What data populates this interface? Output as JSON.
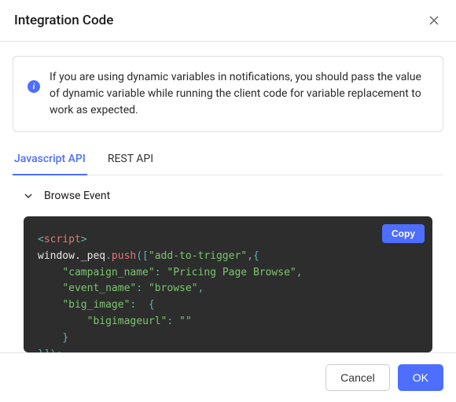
{
  "header": {
    "title": "Integration Code"
  },
  "info": {
    "text": "If you are using dynamic variables in notifications, you should pass the value of dynamic variable while running the client code for variable replacement to work as expected."
  },
  "tabs": [
    {
      "label": "Javascript API",
      "active": true
    },
    {
      "label": "REST API",
      "active": false
    }
  ],
  "section": {
    "title": "Browse Event"
  },
  "copy_label": "Copy",
  "code": {
    "tag_open_lt": "<",
    "tag_name": "script",
    "tag_open_gt": ">",
    "obj": "window._peq",
    "dot": ".",
    "method": "push",
    "open_args": "([",
    "trigger_str": "\"add-to-trigger\"",
    "after_trigger": ",{",
    "indent1": "    ",
    "campaign_key": "\"campaign_name\"",
    "colon_space": ": ",
    "campaign_val": "\"Pricing Page Browse\"",
    "comma": ",",
    "event_key": "\"event_name\"",
    "event_val": "\"browse\"",
    "bigimage_key": "\"big_image\"",
    "open_brace": " {",
    "indent2": "        ",
    "bigurl_key": "\"bigimageurl\"",
    "bigurl_val": "\"\"",
    "close_brace": "}",
    "close_all": "}]);"
  },
  "footer": {
    "cancel": "Cancel",
    "ok": "OK"
  }
}
